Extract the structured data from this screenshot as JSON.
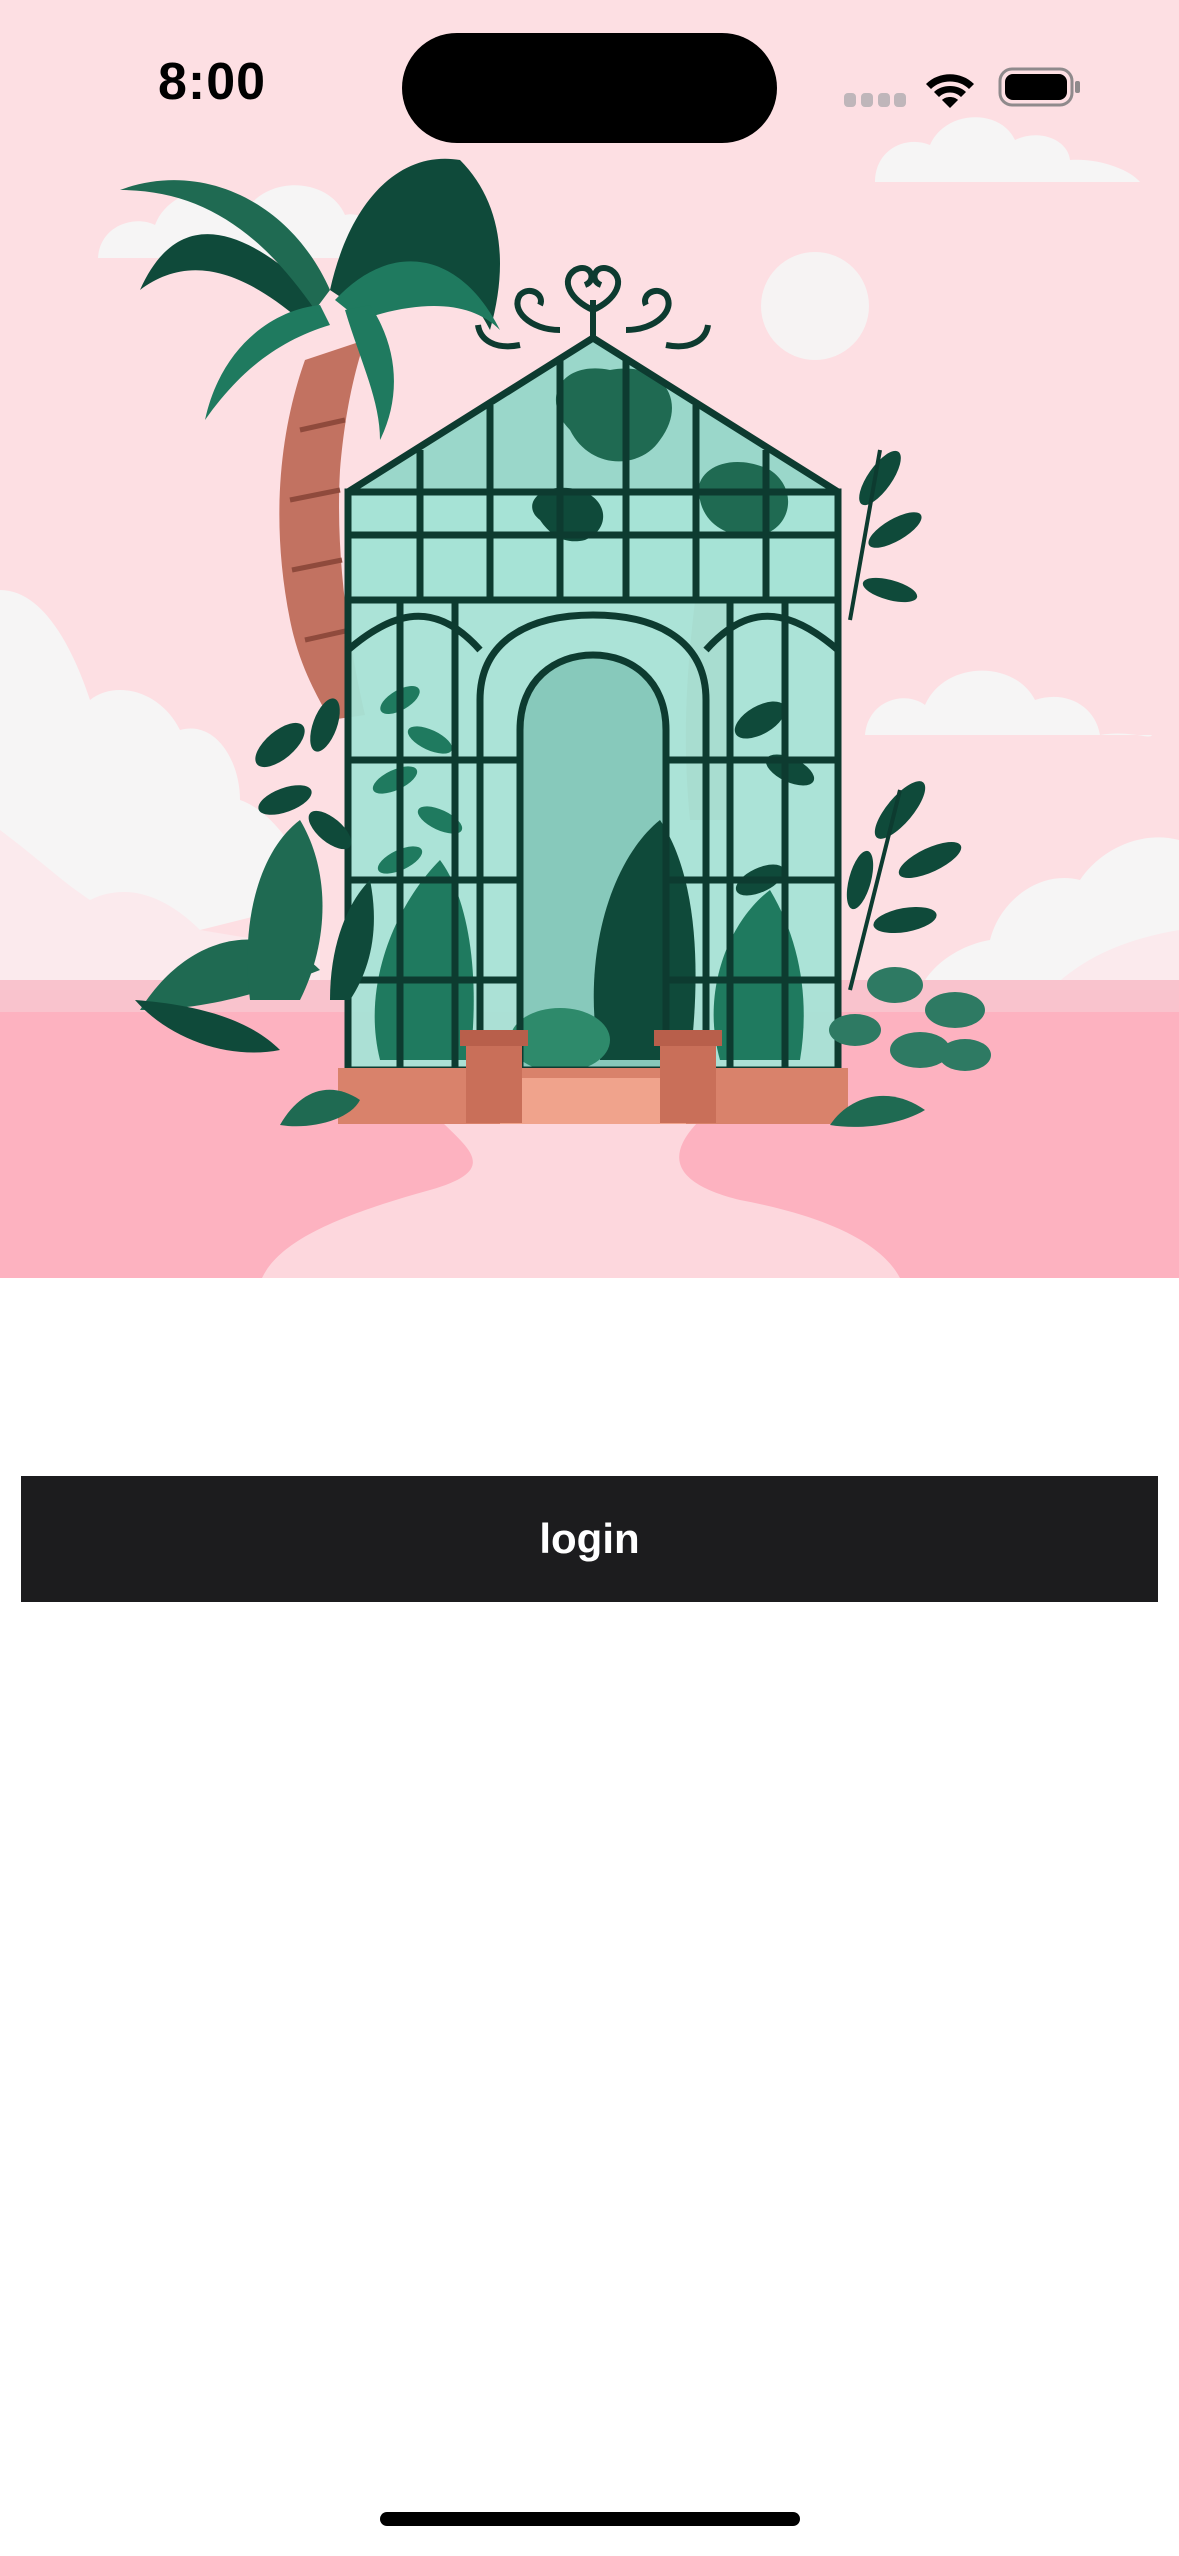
{
  "status_bar": {
    "time": "8:00"
  },
  "hero": {
    "illustration": "greenhouse-illustration",
    "colors": {
      "sky": "#fddfe3",
      "ground": "#fdb2c0",
      "path": "#fdd7dd",
      "cloud": "#f6f5f5",
      "glass": "#a6e3d6",
      "frame": "#0d3b30",
      "leaf_dark": "#0f4a3a",
      "leaf_mid": "#1f7a5f",
      "trunk": "#c27261",
      "base": "#d9826b"
    }
  },
  "actions": {
    "login_label": "login"
  },
  "theme": {
    "button_background": "#1c1c1e",
    "button_text": "#ffffff",
    "page_background": "#ffffff"
  }
}
